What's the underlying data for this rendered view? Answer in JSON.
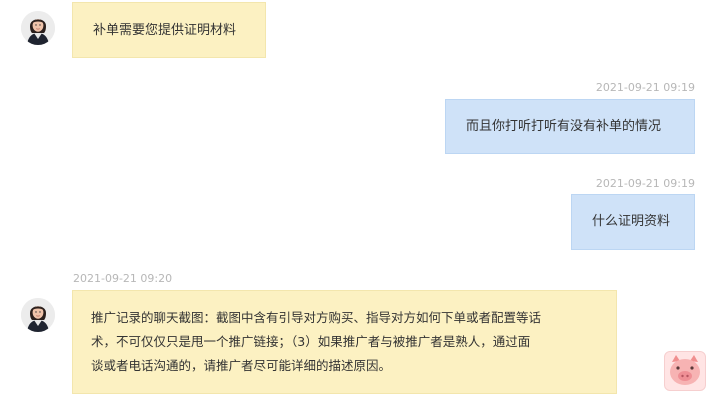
{
  "messages": [
    {
      "sender": "agent",
      "text": "补单需要您提供证明材料"
    },
    {
      "sender": "user",
      "timestamp": "2021-09-21 09:19",
      "text": "而且你打听打听有没有补单的情况"
    },
    {
      "sender": "user",
      "timestamp": "2021-09-21 09:19",
      "text": "什么证明资料"
    },
    {
      "sender": "agent",
      "timestamp": "2021-09-21 09:20",
      "lines": [
        "推广记录的聊天截图：截图中含有引导对方购买、指导对方如何下单或者配置等话",
        "术，不可仅仅只是甩一个推广链接；（3）如果推广者与被推广者是熟人，通过面",
        "谈或者电话沟通的，请推广者尽可能详细的描述原因。"
      ]
    }
  ],
  "icons": {
    "agent_avatar": "agent-avatar-photo",
    "floating_button": "pig-mascot-icon"
  },
  "colors": {
    "agent_bubble": "#fcf1c2",
    "user_bubble": "#cfe2f8",
    "timestamp": "#b7b7b7",
    "mascot": "#f4a6a6"
  }
}
